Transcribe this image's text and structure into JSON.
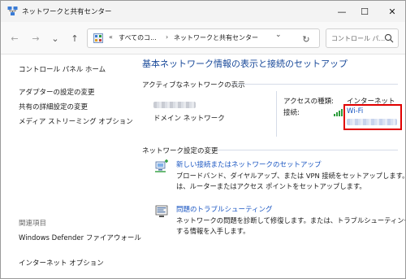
{
  "window": {
    "title": "ネットワークと共有センター",
    "minimize": "—",
    "maximize": "☐",
    "close": "✕"
  },
  "nav": {
    "back": "←",
    "forward": "→",
    "recent": "⌄",
    "up": "↑",
    "address": {
      "prefix": "«",
      "seg1": "すべてのコ...",
      "sep": "›",
      "seg2": "ネットワークと共有センター",
      "dropdown": "⌄"
    },
    "refresh": "↻",
    "search_placeholder": "コントロール パ..."
  },
  "sidebar": {
    "home": "コントロール パネル ホーム",
    "items": [
      "アダプターの設定の変更",
      "共有の詳細設定の変更",
      "メディア ストリーミング オプション"
    ],
    "related_heading": "関連項目",
    "related": [
      "Windows Defender ファイアウォール",
      "インターネット オプション"
    ]
  },
  "main": {
    "title": "基本ネットワーク情報の表示と接続のセットアップ",
    "active_networks_label": "アクティブなネットワークの表示",
    "network_type": "ドメイン ネットワーク",
    "access_type_label": "アクセスの種類:",
    "access_type_value": "インターネット",
    "connections_label": "接続:",
    "connection_name": "Wi-Fi",
    "change_settings_label": "ネットワーク設定の変更",
    "tasks": [
      {
        "title": "新しい接続またはネットワークのセットアップ",
        "desc_line1": "ブロードバンド、ダイヤルアップ、または VPN 接続をセットアップします。あるい",
        "desc_line2": "は、ルーターまたはアクセス ポイントをセットアップします。"
      },
      {
        "title": "問題のトラブルシューティング",
        "desc_line1": "ネットワークの問題を診断して修復します。または、トラブルシューティングに関",
        "desc_line2": "する情報を入手します。"
      }
    ]
  },
  "colors": {
    "link": "#1a56c2",
    "title": "#1a4a9a",
    "highlight": "#e00000"
  }
}
